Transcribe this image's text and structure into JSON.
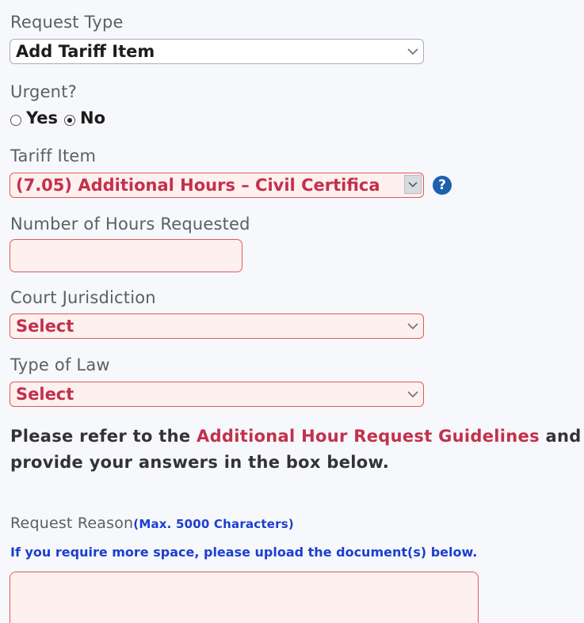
{
  "form": {
    "request_type": {
      "label": "Request Type",
      "value": "Add Tariff Item"
    },
    "urgent": {
      "label": "Urgent?",
      "options": [
        "Yes",
        "No"
      ],
      "selected": "No"
    },
    "tariff_item": {
      "label": "Tariff Item",
      "value": "(7.05) Additional Hours – Civil Certifica",
      "help_icon": "?"
    },
    "hours": {
      "label": "Number of Hours Requested",
      "value": ""
    },
    "court_jurisdiction": {
      "label": "Court Jurisdiction",
      "value": "Select"
    },
    "type_of_law": {
      "label": "Type of Law",
      "value": "Select"
    },
    "instructions": {
      "prefix": "Please refer to the ",
      "link": "Additional Hour Request Guidelines",
      "suffix_line1": " and",
      "line2": "provide your answers in the box below."
    },
    "request_reason": {
      "label": "Request Reason",
      "max_note": "(Max. 5000 Characters)",
      "hint": "If you require more space, please upload the document(s) below.",
      "value": ""
    }
  },
  "colors": {
    "error_border": "#e05a5a",
    "error_bg": "#fdf0ef",
    "link": "#c3304b",
    "hint_blue": "#1c3fd0",
    "help_icon": "#1f5fae"
  },
  "icons": [
    "chevron-down-icon",
    "help-icon",
    "radio-icon"
  ]
}
